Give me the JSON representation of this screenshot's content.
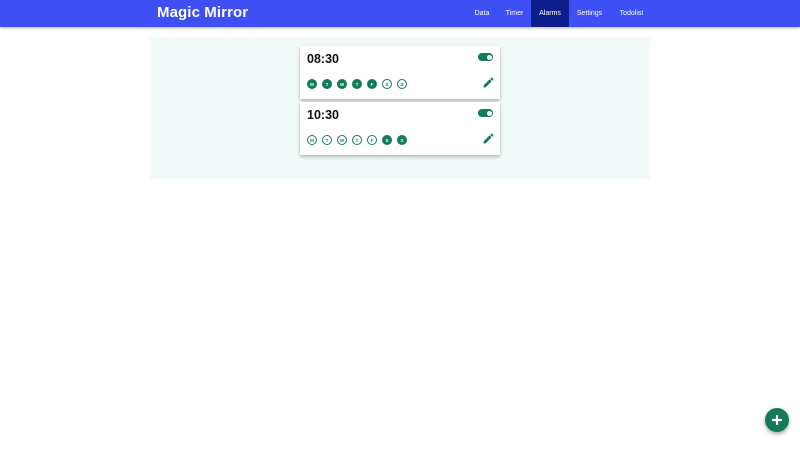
{
  "app": {
    "title": "Magic Mirror"
  },
  "nav": {
    "items": [
      {
        "label": "Data",
        "active": false
      },
      {
        "label": "Timer",
        "active": false
      },
      {
        "label": "Alarms",
        "active": true
      },
      {
        "label": "Settings",
        "active": false
      },
      {
        "label": "Todolist",
        "active": false
      }
    ]
  },
  "alarms": [
    {
      "time": "08:30",
      "enabled": true,
      "days": [
        {
          "label": "M",
          "on": true
        },
        {
          "label": "T",
          "on": true
        },
        {
          "label": "W",
          "on": true
        },
        {
          "label": "T",
          "on": true
        },
        {
          "label": "F",
          "on": true
        },
        {
          "label": "S",
          "on": false
        },
        {
          "label": "S",
          "on": false
        }
      ]
    },
    {
      "time": "10:30",
      "enabled": true,
      "days": [
        {
          "label": "M",
          "on": false
        },
        {
          "label": "T",
          "on": false
        },
        {
          "label": "W",
          "on": false
        },
        {
          "label": "T",
          "on": false
        },
        {
          "label": "F",
          "on": false
        },
        {
          "label": "S",
          "on": true
        },
        {
          "label": "S",
          "on": true
        }
      ]
    }
  ],
  "icons": {
    "edit": "pencil-icon",
    "add": "plus-icon"
  },
  "colors": {
    "nav": "#3d4ff5",
    "nav_active": "#0d1d8c",
    "accent": "#137a55",
    "panel": "#f3fafa"
  }
}
